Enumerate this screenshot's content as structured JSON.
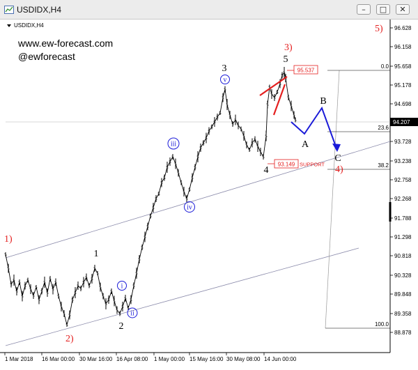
{
  "window": {
    "title": "USDIDX,H4",
    "min_icon": "minimize-icon",
    "max_icon": "maximize-icon",
    "close_icon": "close-icon",
    "min_glyph": "–",
    "max_glyph": "□",
    "close_glyph": "✕"
  },
  "chart_info": "USDIDX,H4",
  "watermark": {
    "site": "www.ew-forecast.com",
    "handle": "@ewforecast"
  },
  "price_axis": {
    "ticks": [
      "96.628",
      "96.158",
      "95.658",
      "95.178",
      "94.698",
      "93.728",
      "93.238",
      "92.758",
      "92.268",
      "91.788",
      "91.298",
      "90.818",
      "90.328",
      "89.848",
      "89.358",
      "88.878"
    ],
    "current_price": "94.207"
  },
  "time_axis": {
    "ticks": [
      "1 Mar 2018",
      "16 Mar 00:00",
      "30 Mar 16:00",
      "16 Apr 08:00",
      "1 May 00:00",
      "15 May 16:00",
      "30 May 08:00",
      "14 Jun 00:00"
    ]
  },
  "price_labels": {
    "high": "95.537",
    "low": "93.149",
    "support": "SUPPORT"
  },
  "fibo": {
    "l0": "0.0",
    "l236": "23.6",
    "l382": "38.2",
    "l100": "100.0"
  },
  "waves": {
    "one": "1",
    "two": "2",
    "three": "3",
    "four": "4",
    "five": "5",
    "A": "A",
    "B": "B",
    "C": "C",
    "r1": "1)",
    "r2": "2)",
    "r3": "3)",
    "r4": "4)",
    "r5": "5)",
    "i": "i",
    "ii": "ii",
    "iii": "iii",
    "iv": "iv",
    "v": "v"
  },
  "colors": {
    "red": "#e41f1f",
    "blue": "#1a1ad8",
    "channel": "#8a8aaa",
    "price_bg": "#000000"
  }
}
